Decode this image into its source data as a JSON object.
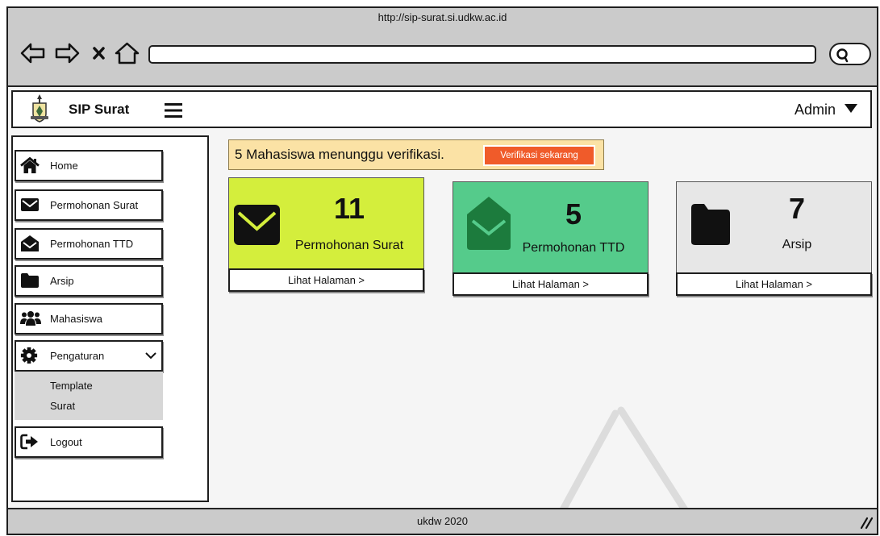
{
  "browser": {
    "url": "http://sip-surat.si.udkw.ac.id",
    "back_icon": "back-arrow-icon",
    "forward_icon": "forward-arrow-icon",
    "stop_icon": "close-icon",
    "home_icon": "home-outline-icon",
    "search_icon": "search-icon"
  },
  "header": {
    "logo_icon": "university-logo",
    "app_title": "SIP Surat",
    "menu_icon": "hamburger-menu-icon",
    "user_label": "Admin",
    "user_menu_icon": "caret-down-icon"
  },
  "sidebar": {
    "items": [
      {
        "label": "Home",
        "icon": "home-icon"
      },
      {
        "label": "Permohonan Surat",
        "icon": "envelope-icon"
      },
      {
        "label": "Permohonan TTD",
        "icon": "envelope-open-icon"
      },
      {
        "label": "Arsip",
        "icon": "folder-icon"
      },
      {
        "label": "Mahasiswa",
        "icon": "users-icon"
      },
      {
        "label": "Pengaturan",
        "icon": "gear-icon",
        "expanded": true,
        "toggle_icon": "chevron-down-icon",
        "submenu": [
          {
            "label": "Template Surat"
          }
        ]
      }
    ],
    "logout": {
      "label": "Logout",
      "icon": "sign-out-icon"
    }
  },
  "notification": {
    "message": "5 Mahasiswa menunggu verifikasi.",
    "action_label": "Verifikasi sekarang",
    "background": "#fbe2a5",
    "action_color": "#f05b2a"
  },
  "cards": [
    {
      "count": 11,
      "label": "Permohonan Surat",
      "link_label": "Lihat Halaman >",
      "icon": "envelope-icon",
      "color": "#d4ee3c"
    },
    {
      "count": 5,
      "label": "Permohonan TTD",
      "link_label": "Lihat Halaman >",
      "icon": "envelope-open-icon",
      "color": "#55cb8b"
    },
    {
      "count": 7,
      "label": "Arsip",
      "link_label": "Lihat Halaman >",
      "icon": "folder-icon",
      "color": "#e7e7e7"
    }
  ],
  "footer": {
    "text": "ukdw 2020",
    "resize_icon": "resize-grip-icon"
  }
}
